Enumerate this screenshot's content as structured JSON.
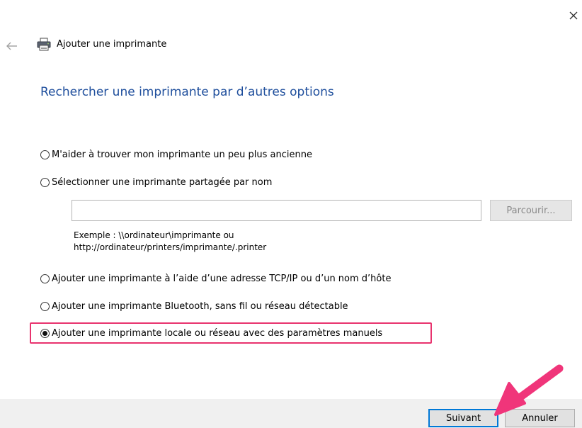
{
  "window": {
    "title": "Ajouter une imprimante",
    "close_icon": "close-icon",
    "back_icon": "back-arrow-icon",
    "title_icon": "printer-icon"
  },
  "heading": "Rechercher une imprimante par d’autres options",
  "options": [
    {
      "label": "M'aider à trouver mon imprimante un peu plus ancienne",
      "checked": false
    },
    {
      "label": "Sélectionner une imprimante partagée par nom",
      "checked": false
    },
    {
      "label": "Ajouter une imprimante à l’aide d’une adresse TCP/IP ou d’un nom d’hôte",
      "checked": false
    },
    {
      "label": "Ajouter une imprimante Bluetooth, sans fil ou réseau détectable",
      "checked": false
    },
    {
      "label": "Ajouter une imprimante locale ou réseau avec des paramètres manuels",
      "checked": true
    }
  ],
  "shared_printer": {
    "value": "",
    "browse_label": "Parcourir...",
    "example_line1": "Exemple : \\\\ordinateur\\imprimante ou",
    "example_line2": "http://ordinateur/printers/imprimante/.printer"
  },
  "footer": {
    "next_label": "Suivant",
    "cancel_label": "Annuler"
  },
  "colors": {
    "heading": "#1e4e9c",
    "highlight": "#e8336e",
    "default_button_border": "#0078d7",
    "footer_bg": "#f0f0f0"
  }
}
